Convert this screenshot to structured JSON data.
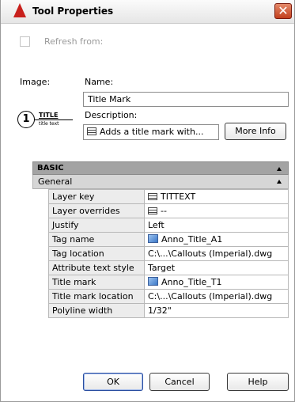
{
  "window": {
    "title": "Tool Properties",
    "close_glyph": "✕"
  },
  "refresh": {
    "label": "Refresh from:",
    "checked": false
  },
  "image": {
    "label": "Image:",
    "preview": {
      "number": "1",
      "title": "TITLE",
      "subtitle": "title text"
    }
  },
  "name": {
    "label": "Name:",
    "value": "Title Mark"
  },
  "description": {
    "label": "Description:",
    "value": "Adds a title mark with..."
  },
  "buttons": {
    "more_info": "More Info",
    "ok": "OK",
    "cancel": "Cancel",
    "help": "Help"
  },
  "categories": {
    "basic": "BASIC",
    "general": "General"
  },
  "properties": [
    {
      "name": "Layer key",
      "value": "TITTEXT",
      "icon": "list-icon"
    },
    {
      "name": "Layer overrides",
      "value": "--",
      "icon": "list-icon"
    },
    {
      "name": "Justify",
      "value": "Left",
      "icon": ""
    },
    {
      "name": "Tag name",
      "value": "Anno_Title_A1",
      "icon": "block-icon"
    },
    {
      "name": "Tag location",
      "value": "C:\\...\\Callouts (Imperial).dwg",
      "icon": ""
    },
    {
      "name": "Attribute text style",
      "value": "Target",
      "icon": ""
    },
    {
      "name": "Title mark",
      "value": "Anno_Title_T1",
      "icon": "block-icon"
    },
    {
      "name": "Title mark location",
      "value": "C:\\...\\Callouts (Imperial).dwg",
      "icon": ""
    },
    {
      "name": "Polyline width",
      "value": "1/32\"",
      "icon": ""
    }
  ],
  "colors": {
    "title_icon": "#c8201c",
    "close_button": "#c23f1d",
    "category_basic": "#a3a3a3"
  }
}
